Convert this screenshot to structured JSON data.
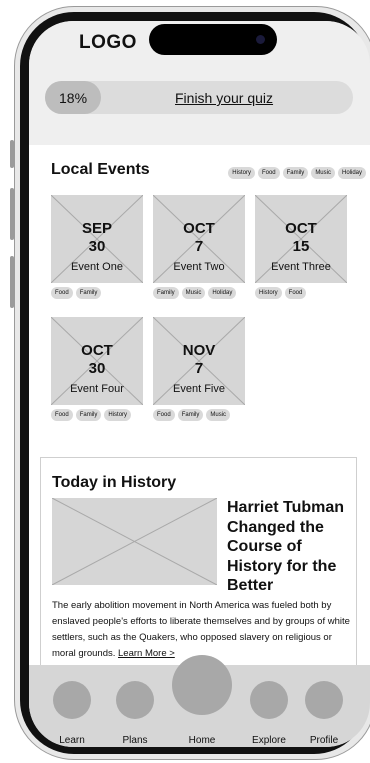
{
  "header": {
    "logo": "LOGO"
  },
  "quiz": {
    "percent": "18%",
    "progress_fraction": 0.18,
    "link_label": "Finish your quiz"
  },
  "events": {
    "title": "Local Events",
    "filters": [
      "History",
      "Food",
      "Family",
      "Music",
      "Holiday"
    ],
    "items": [
      {
        "month": "SEP",
        "day": "30",
        "name": "Event One",
        "tags": [
          "Food",
          "Family"
        ]
      },
      {
        "month": "OCT",
        "day": "7",
        "name": "Event Two",
        "tags": [
          "Family",
          "Music",
          "Holiday"
        ]
      },
      {
        "month": "OCT",
        "day": "15",
        "name": "Event Three",
        "tags": [
          "History",
          "Food"
        ]
      },
      {
        "month": "OCT",
        "day": "30",
        "name": "Event Four",
        "tags": [
          "Food",
          "Family",
          "History"
        ]
      },
      {
        "month": "NOV",
        "day": "7",
        "name": "Event Five",
        "tags": [
          "Food",
          "Family",
          "Music"
        ]
      }
    ]
  },
  "history": {
    "title": "Today in History",
    "headline": "Harriet Tubman Changed the Course of History for the Better",
    "body": "The early abolition movement in North America was fueled both by enslaved people's efforts to liberate themselves and by groups of white settlers, such as the Quakers, who opposed slavery on religious or moral grounds.",
    "learn_more": "Learn More >"
  },
  "nav": {
    "items": [
      {
        "label": "Learn",
        "icon": "learn-icon"
      },
      {
        "label": "Plans",
        "icon": "plans-icon"
      },
      {
        "label": "Home",
        "icon": "home-icon"
      },
      {
        "label": "Explore",
        "icon": "explore-icon"
      },
      {
        "label": "Profile",
        "icon": "profile-icon"
      }
    ]
  }
}
